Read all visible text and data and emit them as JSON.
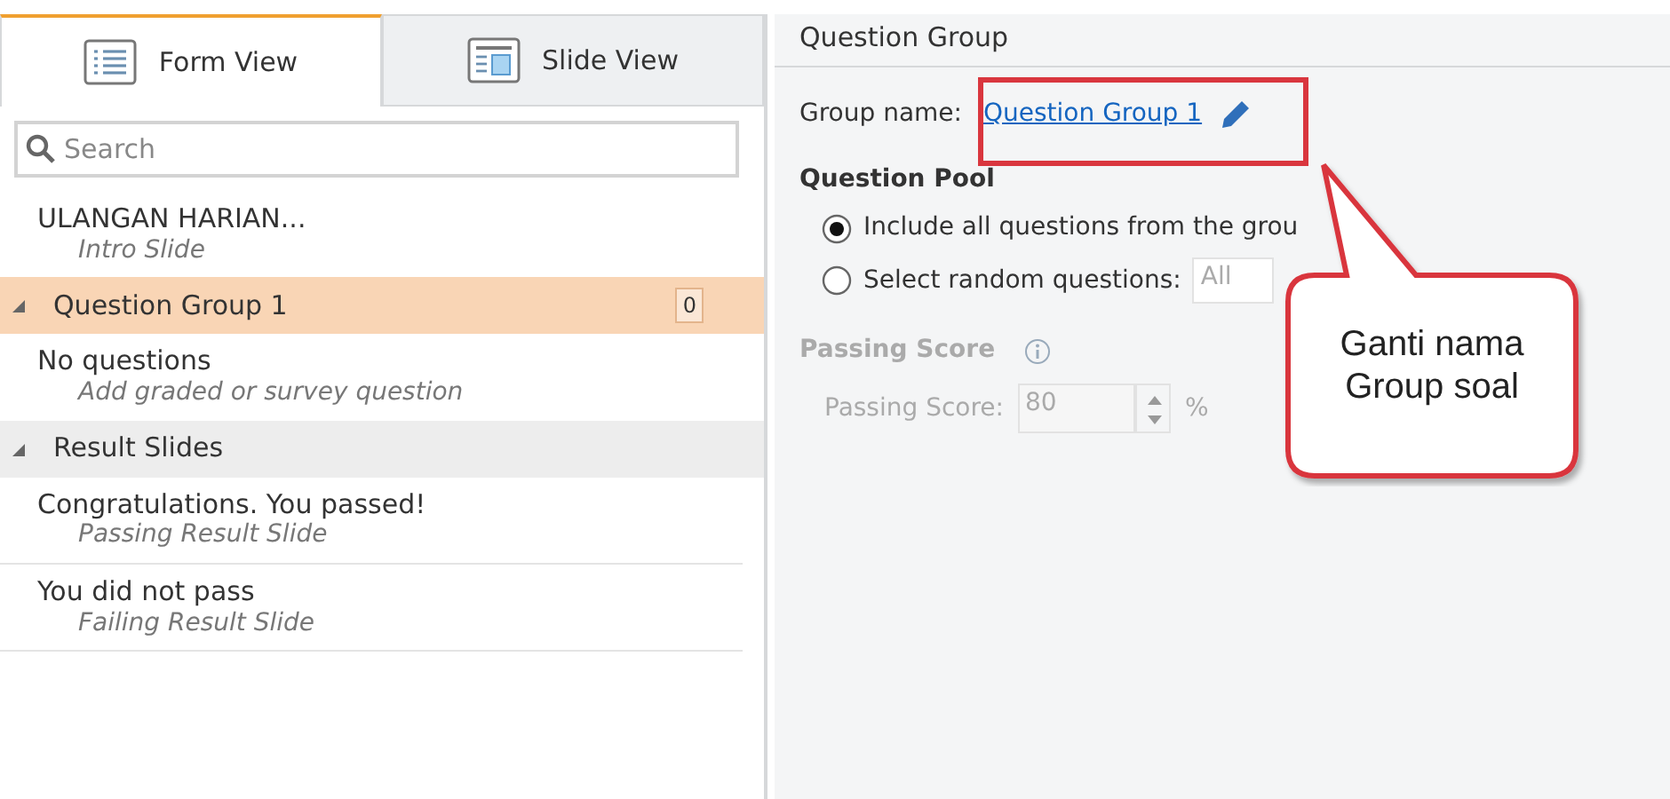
{
  "tabs": [
    {
      "label": "Form View",
      "kind": "list",
      "selected": true
    },
    {
      "label": "Slide View",
      "kind": "slide",
      "selected": false
    }
  ],
  "search": {
    "placeholder": "Search"
  },
  "outline": [
    {
      "kind": "slide",
      "title": "ULANGAN HARIAN...",
      "subtitle": "Intro Slide",
      "selected": false
    },
    {
      "kind": "group",
      "label": "Question Group 1",
      "count": "0",
      "expanded": true,
      "selected": true
    },
    {
      "kind": "slide",
      "title": "No questions",
      "subtitle": "Add graded or survey question",
      "selected": false
    },
    {
      "kind": "group",
      "label": "Result Slides",
      "expanded": true,
      "selected": false
    },
    {
      "kind": "slide",
      "title": "Congratulations. You passed!",
      "subtitle": "Passing Result Slide",
      "selected": false
    },
    {
      "kind": "slide",
      "title": "You did not pass",
      "subtitle": "Failing Result Slide",
      "selected": false
    }
  ],
  "panel": {
    "title": "Question Group",
    "group_name_label": "Group name:",
    "group_name": "Question Group 1",
    "pool_title": "Question Pool",
    "pool_options": [
      {
        "label": "Include all questions from the grou",
        "selected": true
      },
      {
        "label": "Select random questions:",
        "selected": false,
        "value": "All"
      }
    ],
    "passing": {
      "title": "Passing Score",
      "disabled": true,
      "label": "Passing Score:",
      "value": "80",
      "unit": "%"
    }
  },
  "callout": {
    "lines": [
      "Ganti nama",
      "Group soal"
    ]
  }
}
